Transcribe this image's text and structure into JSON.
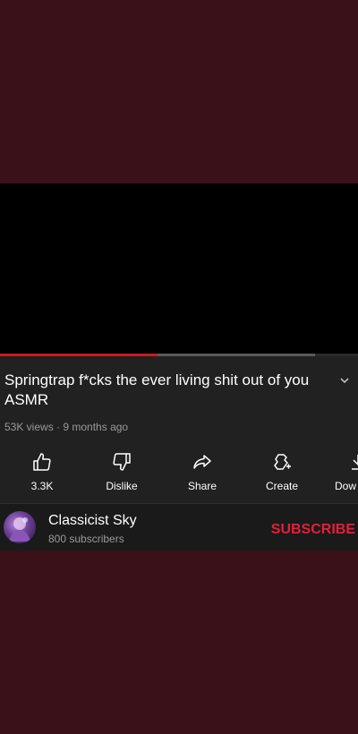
{
  "video": {
    "title": "Springtrap f*cks the ever living shit out of you ASMR",
    "views": "53K views",
    "age": "9 months ago",
    "meta_separator": " · ",
    "progress_fraction": 0.44
  },
  "actions": [
    {
      "label": "3.3K",
      "icon": "thumbs-up-icon"
    },
    {
      "label": "Dislike",
      "icon": "thumbs-down-icon"
    },
    {
      "label": "Share",
      "icon": "share-icon"
    },
    {
      "label": "Create",
      "icon": "create-icon"
    },
    {
      "label": "Dow",
      "icon": "download-icon"
    }
  ],
  "channel": {
    "name": "Classicist Sky",
    "subscribers": "800 subscribers",
    "subscribe_label": "SUBSCRIBE"
  },
  "colors": {
    "background": "#3a1019",
    "panel": "#212121",
    "accent": "#e0213a",
    "progress": "#cc1a1a"
  }
}
